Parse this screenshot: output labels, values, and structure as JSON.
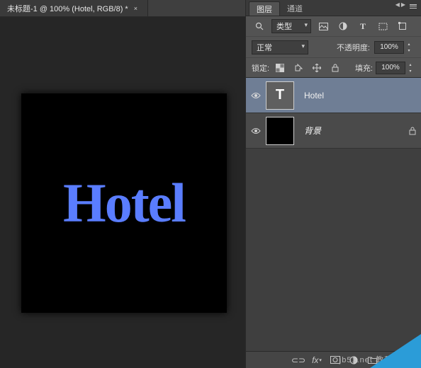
{
  "tab": {
    "title": "未标题-1 @ 100% (Hotel, RGB/8) *",
    "close": "×"
  },
  "canvas": {
    "text": "Hotel"
  },
  "panel": {
    "tabs": {
      "layers": "图层",
      "channels": "通道"
    },
    "filter": {
      "label": "类型"
    },
    "filter_icons": {
      "image": "image-filter-icon",
      "adjustment": "adjustment-filter-icon",
      "type": "type-filter-icon",
      "shape": "shape-filter-icon",
      "smart": "smart-filter-icon"
    },
    "blend": {
      "mode": "正常",
      "opacity_label": "不透明度:",
      "opacity_value": "100%"
    },
    "lock": {
      "label": "锁定:",
      "fill_label": "填充:",
      "fill_value": "100%"
    },
    "layers": [
      {
        "name": "Hotel",
        "type": "text",
        "selected": true,
        "visible": true,
        "locked": false
      },
      {
        "name": "背景",
        "type": "pixel",
        "selected": false,
        "visible": true,
        "locked": true,
        "italic": true
      }
    ],
    "thumb_letter": "T"
  },
  "watermark": "jb51.net  教程"
}
